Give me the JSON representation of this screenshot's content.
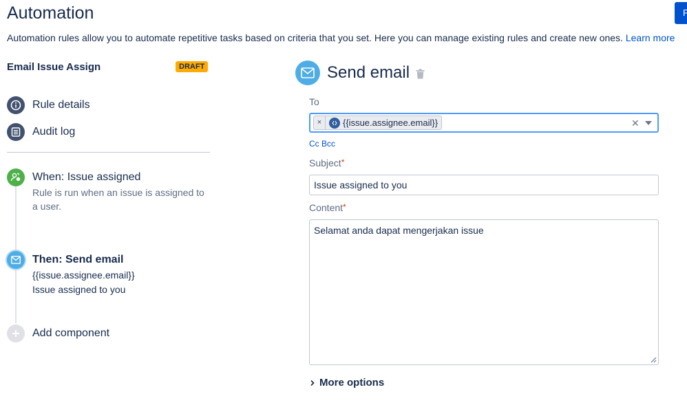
{
  "header": {
    "title": "Automation",
    "primary_button_label": "P",
    "description": "Automation rules allow you to automate repetitive tasks based on criteria that you set. Here you can manage existing rules and create new ones.",
    "learn_more": "Learn more"
  },
  "rule": {
    "name": "Email Issue Assign",
    "status_badge": "DRAFT"
  },
  "nav": [
    {
      "label": "Rule details",
      "icon": "info-icon"
    },
    {
      "label": "Audit log",
      "icon": "list-icon"
    }
  ],
  "steps": {
    "trigger": {
      "title": "When: Issue assigned",
      "subtitle_line1": "Rule is run when an issue is assigned to",
      "subtitle_line2": "a user.",
      "icon": "assign-user-icon",
      "color": "#4fb04a"
    },
    "action": {
      "title": "Then: Send email",
      "line1": "{{issue.assignee.email}}",
      "line2": "Issue assigned to you",
      "icon": "mail-icon",
      "color": "#4fade6"
    },
    "add": {
      "label": "Add component",
      "icon": "plus-icon"
    }
  },
  "editor": {
    "title": "Send email",
    "to_label": "To",
    "to_chip": "{{issue.assignee.email}}",
    "cc_bcc": "Cc Bcc",
    "subject_label": "Subject",
    "subject_value": "Issue assigned to you",
    "content_label": "Content",
    "content_value": "Selamat anda dapat mengerjakan issue",
    "required_mark": "*",
    "more_options": "More options",
    "accent": "#0052cc",
    "focus_border": "#4c9aff"
  }
}
